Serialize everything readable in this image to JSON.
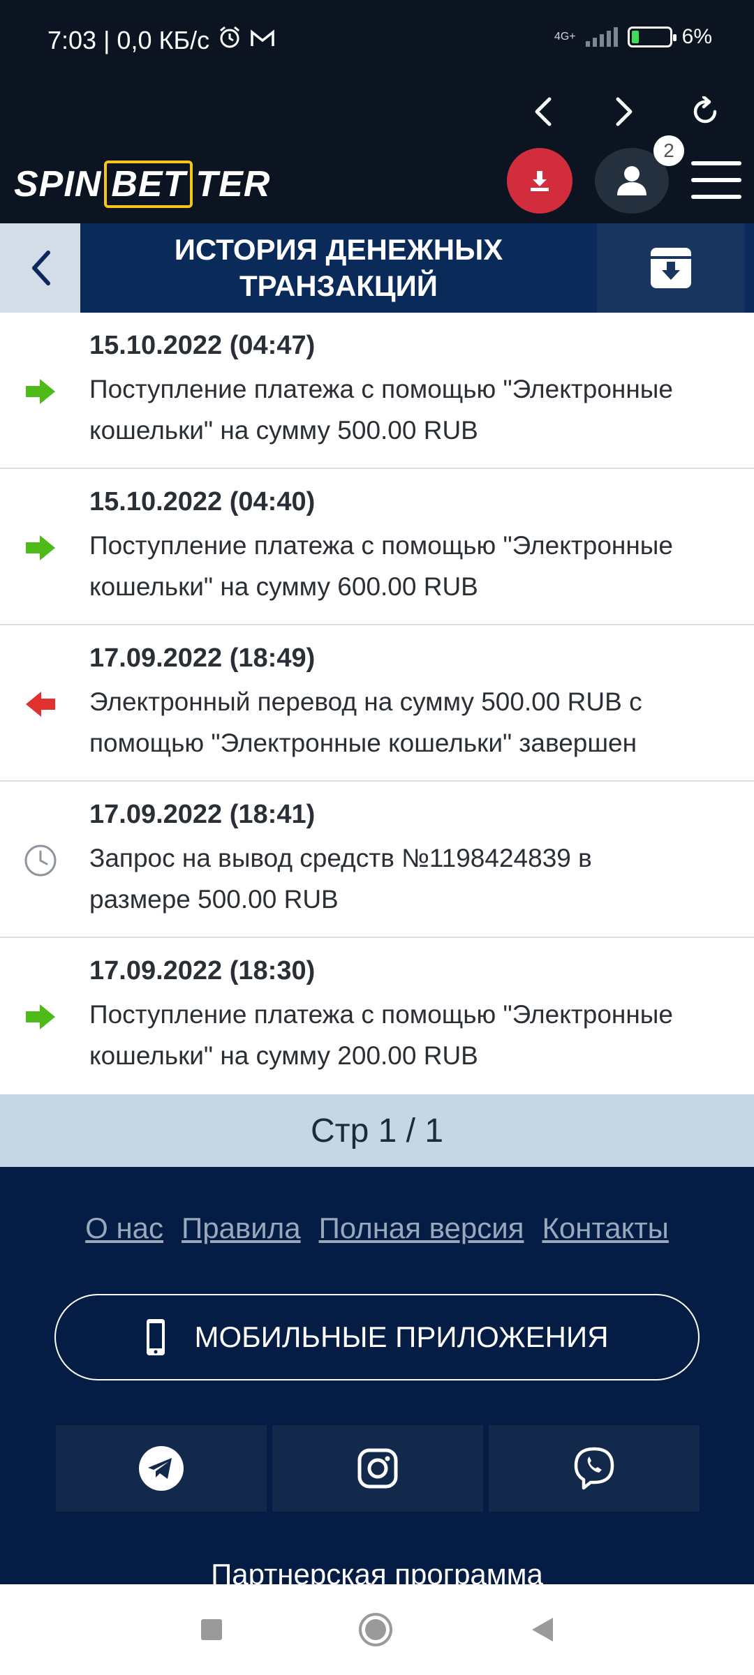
{
  "status_bar": {
    "time_and_speed": "7:03 | 0,0 КБ/с",
    "network": "4G+",
    "battery": "6%"
  },
  "header": {
    "logo_pre": "SPIN",
    "logo_bet": "BET",
    "logo_post": "TER",
    "notification_count": "2"
  },
  "page": {
    "title_line1": "ИСТОРИЯ ДЕНЕЖНЫХ",
    "title_line2": "ТРАНЗАКЦИЙ"
  },
  "transactions": [
    {
      "icon": "arrow-in-icon",
      "date": "15.10.2022 (04:47)",
      "line1": "Поступление платежа с помощью \"Электронные",
      "line2": "кошельки\" на сумму 500.00 RUB"
    },
    {
      "icon": "arrow-in-icon",
      "date": "15.10.2022 (04:40)",
      "line1": "Поступление платежа с помощью \"Электронные",
      "line2": "кошельки\" на сумму 600.00 RUB"
    },
    {
      "icon": "arrow-out-icon",
      "date": "17.09.2022 (18:49)",
      "line1": "Электронный перевод на сумму 500.00 RUB с",
      "line2": "помощью \"Электронные кошельки\" завершен"
    },
    {
      "icon": "clock-icon",
      "date": "17.09.2022 (18:41)",
      "line1": "Запрос на вывод средств №1198424839 в",
      "line2": "размере 500.00 RUB"
    },
    {
      "icon": "arrow-in-icon",
      "date": "17.09.2022 (18:30)",
      "line1": "Поступление платежа с помощью \"Электронные",
      "line2": "кошельки\" на сумму 200.00 RUB"
    }
  ],
  "pager": {
    "label": "Стр 1 / 1"
  },
  "footer": {
    "links": [
      "О нас",
      "Правила",
      "Полная версия",
      "Контакты"
    ],
    "apps_button": "МОБИЛЬНЫЕ ПРИЛОЖЕНИЯ",
    "social": [
      "telegram-icon",
      "instagram-icon",
      "viber-icon"
    ],
    "partner": "Партнерская программа"
  },
  "colors": {
    "header_bg": "#0b1420",
    "title_bg": "#0a2a5a",
    "footer_bg": "#051c45",
    "incoming": "#4cbb17",
    "outgoing": "#e0312f",
    "download_btn": "#d22d3d",
    "pager_bg": "#c5d6e4"
  }
}
